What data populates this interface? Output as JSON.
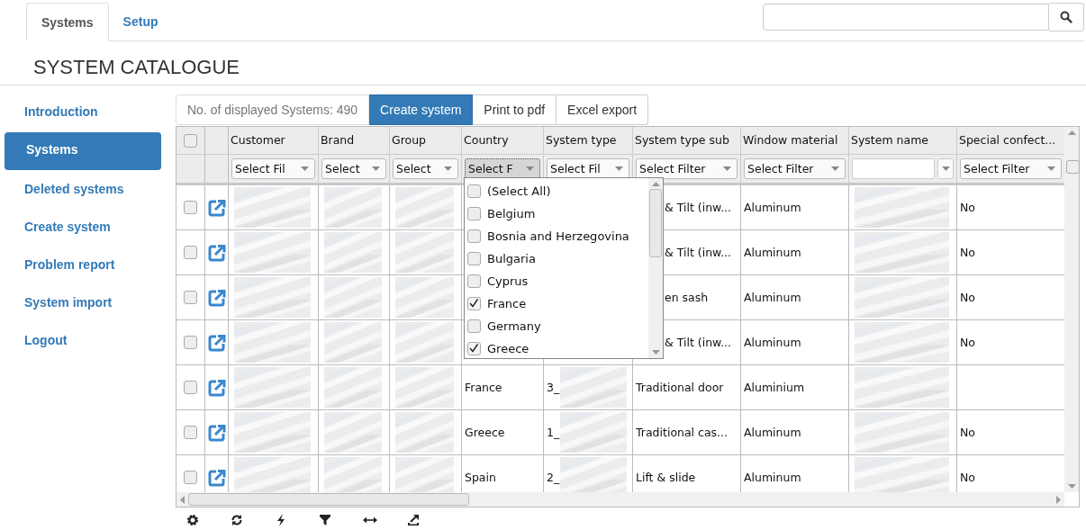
{
  "tabs": [
    {
      "label": "Systems",
      "selected": true
    },
    {
      "label": "Setup",
      "selected": false
    }
  ],
  "title": "SYSTEM CATALOGUE",
  "sidebar": {
    "items": [
      {
        "label": "Introduction",
        "selected": false
      },
      {
        "label": "Systems",
        "selected": true
      },
      {
        "label": "Deleted systems",
        "selected": false
      },
      {
        "label": "Create system",
        "selected": false
      },
      {
        "label": "Problem report",
        "selected": false
      },
      {
        "label": "System import",
        "selected": false
      },
      {
        "label": "Logout",
        "selected": false
      }
    ]
  },
  "toolbar": {
    "count": "No. of displayed Systems: 490",
    "buttons": [
      {
        "label": "Create system",
        "selected": true
      },
      {
        "label": "Print to pdf",
        "selected": false
      },
      {
        "label": "Excel export",
        "selected": false
      }
    ]
  },
  "table": {
    "select_all_checked": false,
    "side_checkbox_checked": false,
    "columns": [
      {
        "label": "Customer",
        "filter": "Select Fil",
        "kind": "select",
        "open": false
      },
      {
        "label": "Brand",
        "filter": "Select",
        "kind": "select",
        "open": false
      },
      {
        "label": "Group",
        "filter": "Select",
        "kind": "select",
        "open": false
      },
      {
        "label": "Country",
        "filter": "Select F",
        "kind": "select",
        "open": true
      },
      {
        "label": "System type",
        "filter": "Select Fil",
        "kind": "select",
        "open": false
      },
      {
        "label": "System type sub",
        "filter": "Select Filter",
        "kind": "select",
        "open": false
      },
      {
        "label": "Window material",
        "filter": "Select Filter",
        "kind": "select",
        "open": false
      },
      {
        "label": "System name",
        "kind": "input",
        "open": false
      },
      {
        "label": "Special confect...",
        "filter": "Select Filter",
        "kind": "select",
        "open": false
      }
    ],
    "rows": [
      {
        "checked": false,
        "under_menu": true,
        "cells": [
          {
            "kind": "blurred"
          },
          {
            "kind": "blurred"
          },
          {
            "kind": "blurred"
          },
          null,
          null,
          {
            "kind": "text",
            "text": "& Tilt (inw..."
          },
          {
            "kind": "text",
            "text": "Aluminum"
          },
          {
            "kind": "blurred"
          },
          {
            "kind": "text",
            "text": "No"
          }
        ]
      },
      {
        "checked": false,
        "under_menu": true,
        "cells": [
          {
            "kind": "blurred"
          },
          {
            "kind": "blurred"
          },
          {
            "kind": "blurred"
          },
          null,
          null,
          {
            "kind": "text",
            "text": "& Tilt (inw..."
          },
          {
            "kind": "text",
            "text": "Aluminum"
          },
          {
            "kind": "blurred"
          },
          {
            "kind": "text",
            "text": "No"
          }
        ]
      },
      {
        "checked": false,
        "under_menu": true,
        "cells": [
          {
            "kind": "blurred"
          },
          {
            "kind": "blurred"
          },
          {
            "kind": "blurred"
          },
          null,
          null,
          {
            "kind": "text",
            "text": "en sash"
          },
          {
            "kind": "text",
            "text": "Aluminum"
          },
          {
            "kind": "blurred"
          },
          {
            "kind": "text",
            "text": "No"
          }
        ]
      },
      {
        "checked": false,
        "under_menu": true,
        "cells": [
          {
            "kind": "blurred"
          },
          {
            "kind": "blurred"
          },
          {
            "kind": "blurred"
          },
          null,
          null,
          {
            "kind": "text",
            "text": "& Tilt (inw..."
          },
          {
            "kind": "text",
            "text": "Aluminum"
          },
          {
            "kind": "blurred"
          },
          {
            "kind": "text",
            "text": "No"
          }
        ]
      },
      {
        "checked": false,
        "under_menu": false,
        "cells": [
          {
            "kind": "blurred"
          },
          {
            "kind": "blurred"
          },
          {
            "kind": "blurred"
          },
          {
            "kind": "text",
            "text": "France"
          },
          {
            "kind": "blurred",
            "text": "3_"
          },
          {
            "kind": "text",
            "text": "Traditional door"
          },
          {
            "kind": "text",
            "text": "Aluminium"
          },
          {
            "kind": "blurred"
          },
          null
        ]
      },
      {
        "checked": false,
        "under_menu": false,
        "cells": [
          {
            "kind": "blurred"
          },
          {
            "kind": "blurred"
          },
          {
            "kind": "blurred"
          },
          {
            "kind": "text",
            "text": "Greece"
          },
          {
            "kind": "blurred",
            "text": "1_"
          },
          {
            "kind": "text",
            "text": "Traditional cas..."
          },
          {
            "kind": "text",
            "text": "Aluminum"
          },
          {
            "kind": "blurred"
          },
          {
            "kind": "text",
            "text": "No"
          }
        ]
      },
      {
        "checked": false,
        "under_menu": false,
        "cells": [
          {
            "kind": "blurred"
          },
          {
            "kind": "blurred"
          },
          {
            "kind": "blurred"
          },
          {
            "kind": "text",
            "text": "Spain"
          },
          {
            "kind": "blurred",
            "text": "2_"
          },
          {
            "kind": "text",
            "text": "Lift & slide"
          },
          {
            "kind": "text",
            "text": "Aluminum"
          },
          {
            "kind": "blurred"
          },
          {
            "kind": "text",
            "text": "No"
          }
        ]
      }
    ]
  },
  "filter_menu": {
    "items": [
      {
        "label": "(Select All)",
        "checked": false
      },
      {
        "label": "Belgium",
        "checked": false
      },
      {
        "label": "Bosnia and Herzegovina",
        "checked": false
      },
      {
        "label": "Bulgaria",
        "checked": false
      },
      {
        "label": "Cyprus",
        "checked": false
      },
      {
        "label": "France",
        "checked": true
      },
      {
        "label": "Germany",
        "checked": false
      },
      {
        "label": "Greece",
        "checked": true
      }
    ]
  },
  "bottom_tools": [
    {
      "kind": "gear"
    },
    {
      "kind": "refresh"
    },
    {
      "kind": "bolt"
    },
    {
      "kind": "filter"
    },
    {
      "kind": "resize"
    },
    {
      "kind": "export"
    }
  ]
}
